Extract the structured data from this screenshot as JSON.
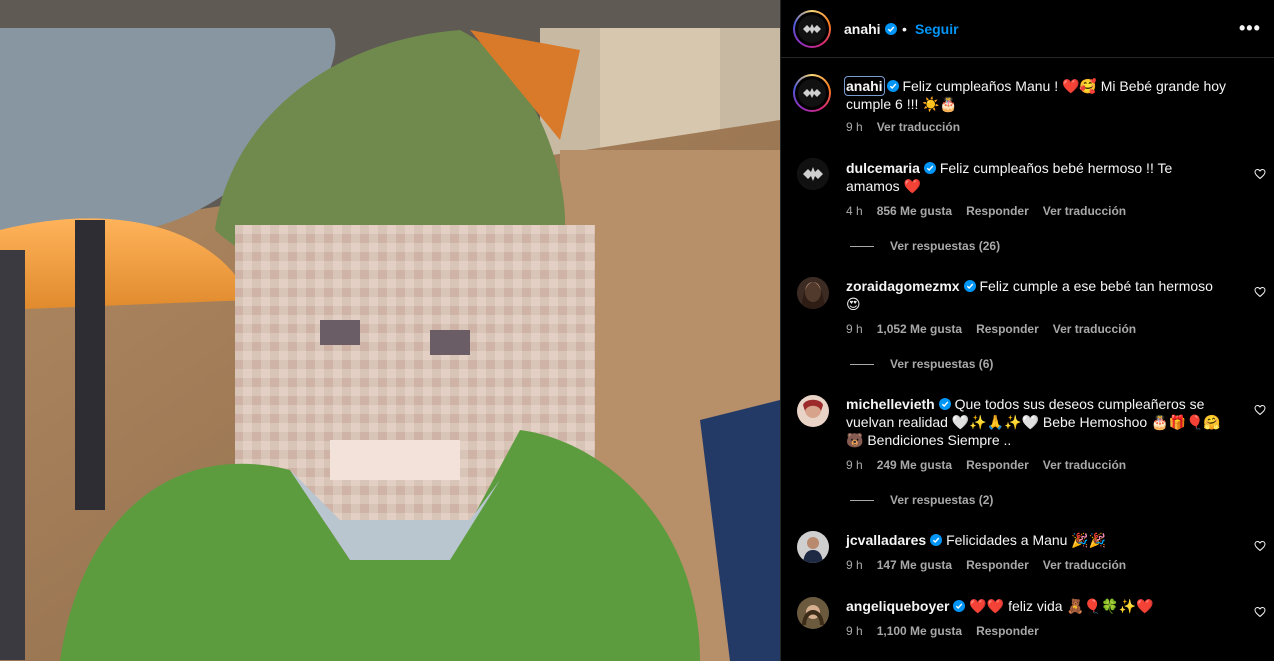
{
  "post": {
    "author": "anahi",
    "follow_label": "Seguir",
    "separator": "•",
    "more_label": "•••"
  },
  "caption": {
    "username": "anahi",
    "text": "Feliz cumpleaños Manu ! ❤️🥰 Mi Bebé grande hoy cumple 6 !!! ☀️🎂",
    "time": "9 h",
    "translate": "Ver traducción"
  },
  "comments": [
    {
      "username": "dulcemaria",
      "text": "Feliz cumpleaños bebé hermoso !! Te amamos ❤️",
      "time": "4 h",
      "likes": "856 Me gusta",
      "reply": "Responder",
      "translate": "Ver traducción",
      "replies": "Ver respuestas (26)"
    },
    {
      "username": "zoraidagomezmx",
      "text": "Feliz cumple a ese bebé tan hermoso 😍",
      "time": "9 h",
      "likes": "1,052 Me gusta",
      "reply": "Responder",
      "translate": "Ver traducción",
      "replies": "Ver respuestas (6)"
    },
    {
      "username": "michellevieth",
      "text": "Que todos sus deseos cumpleañeros se vuelvan realidad 🤍✨🙏✨🤍 Bebe Hemoshoo 🎂🎁🎈🤗 🐻 Bendiciones Siempre ..",
      "time": "9 h",
      "likes": "249 Me gusta",
      "reply": "Responder",
      "translate": "Ver traducción",
      "replies": "Ver respuestas (2)"
    },
    {
      "username": "jcvalladares",
      "text": "Felicidades a Manu 🎉🎉",
      "time": "9 h",
      "likes": "147 Me gusta",
      "reply": "Responder",
      "translate": "Ver traducción"
    },
    {
      "username": "angeliqueboyer",
      "text": "❤️❤️ feliz vida 🧸🎈🍀✨❤️",
      "time": "9 h",
      "likes": "1,100 Me gusta",
      "reply": "Responder"
    }
  ],
  "colors": {
    "background": "#000000",
    "text": "#f5f5f5",
    "secondary": "#a8a8a8",
    "link": "#0095f6",
    "verified": "#0095f6"
  },
  "icons": [
    "verified-icon",
    "heart-icon",
    "more-options-icon"
  ]
}
